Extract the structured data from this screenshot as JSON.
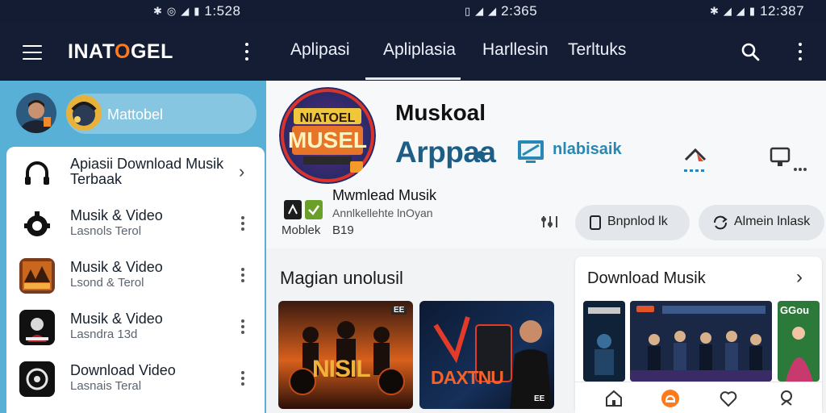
{
  "status_bar": {
    "left_time": "1:528",
    "center_time": "2:365",
    "right_time": "12:387"
  },
  "app_bar": {
    "logo": {
      "prefix": "INAT",
      "o": "O",
      "suffix": "GEL"
    },
    "tabs": [
      {
        "label": "Aplipasi"
      },
      {
        "label": "Apliplasia",
        "active": true
      },
      {
        "label": "Harllesin"
      },
      {
        "label": "Terltuks"
      }
    ]
  },
  "drawer": {
    "user": {
      "name": "Mattobel"
    },
    "items": [
      {
        "title": "Apiasii Download Musik",
        "title2": "Terbaak",
        "icon": "headphones-icon",
        "action": "chevron"
      },
      {
        "title": "Musik & Video",
        "subtitle": "Lasnols Terol",
        "icon": "gear-music-icon",
        "action": "menu"
      },
      {
        "title": "Musik & Video",
        "subtitle": "Lsond & Terol",
        "icon": "album-art",
        "action": "menu"
      },
      {
        "title": "Musik & Video",
        "subtitle": "Lasndra 13d",
        "icon": "album-art",
        "action": "menu"
      },
      {
        "title": "Download Video",
        "subtitle": "Lasnais Teral",
        "icon": "disc-icon",
        "action": "menu"
      }
    ]
  },
  "hero": {
    "app_icon_text": {
      "line1": "NIATOEL",
      "line2": "MUSEL"
    },
    "title": "Muskoal",
    "brand": "Arppaa",
    "partner": "nlabisaik",
    "sub_title": "Mwmlead Musik",
    "sub_desc": "Annlkellehte lnOyan",
    "label_a": "Moblek",
    "label_b": "B19",
    "btn1": "Bnpnlod lk",
    "btn2": "Almein lnlask"
  },
  "featured": {
    "title": "Magian unolusil",
    "cards": [
      {
        "overlay": "NISIL",
        "tag": "EE"
      },
      {
        "overlay": "DAXTNU",
        "tag": "EE"
      }
    ]
  },
  "side_card": {
    "title": "Download Musik",
    "thumb_label": "GGou"
  },
  "colors": {
    "app_bar": "#151d35",
    "drawer_header": "#58b0d6",
    "accent": "#ff7a1a",
    "brand": "#1d5e86"
  }
}
